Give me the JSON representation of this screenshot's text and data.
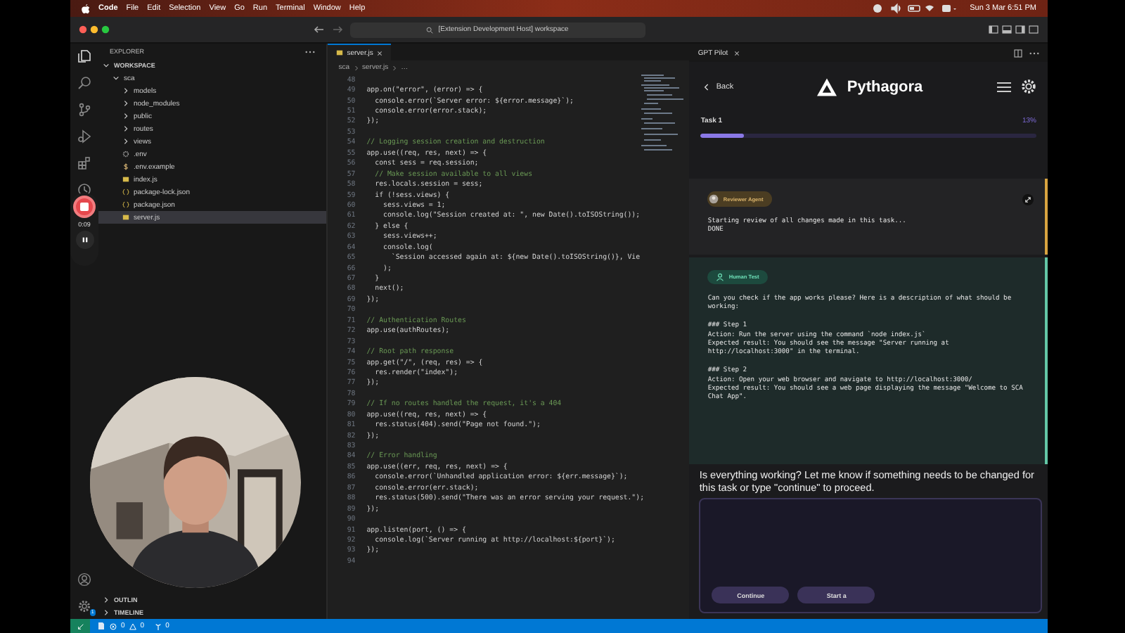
{
  "menu_bar": {
    "app": "Code",
    "items": [
      "File",
      "Edit",
      "Selection",
      "View",
      "Go",
      "Run",
      "Terminal",
      "Window",
      "Help"
    ],
    "clock": "Sun 3 Mar 6:51 PM"
  },
  "title_bar": {
    "command_center": "[Extension Development Host] workspace"
  },
  "activity_bar": {
    "settings_badge": "1"
  },
  "recorder": {
    "time": "0:09"
  },
  "explorer": {
    "title": "EXPLORER",
    "tree": [
      {
        "label": "WORKSPACE",
        "kind": "section",
        "expanded": true,
        "selected": false,
        "children": [
          {
            "label": "sca",
            "kind": "folder",
            "expanded": true,
            "selected": false,
            "children": [
              {
                "label": "models",
                "kind": "folder",
                "expanded": false,
                "selected": false
              },
              {
                "label": "node_modules",
                "kind": "folder",
                "expanded": false,
                "selected": false
              },
              {
                "label": "public",
                "kind": "folder",
                "expanded": false,
                "selected": false
              },
              {
                "label": "routes",
                "kind": "folder",
                "expanded": false,
                "selected": false
              },
              {
                "label": "views",
                "kind": "folder",
                "expanded": false,
                "selected": false
              },
              {
                "label": ".env",
                "kind": "settings",
                "selected": false
              },
              {
                "label": ".env.example",
                "kind": "dollar",
                "selected": false
              },
              {
                "label": "index.js",
                "kind": "js",
                "selected": false
              },
              {
                "label": "package-lock.json",
                "kind": "json",
                "selected": false
              },
              {
                "label": "package.json",
                "kind": "json",
                "selected": false
              },
              {
                "label": "server.js",
                "kind": "js",
                "selected": true
              }
            ]
          }
        ]
      }
    ],
    "bottom_sections": [
      {
        "label": "OUTLIN",
        "expanded": false
      },
      {
        "label": "TIMELINE",
        "expanded": false
      }
    ]
  },
  "editor": {
    "tab": "server.js",
    "breadcrumbs": [
      "sca",
      "server.js",
      "…"
    ],
    "lines": [
      {
        "n": "48"
      },
      {
        "n": "49",
        "text": "app.on(\"error\", (error) => {",
        "kind": "code"
      },
      {
        "n": "50",
        "text": "  console.error(`Server error: ${error.message}`);",
        "kind": "code"
      },
      {
        "n": "51",
        "text": "  console.error(error.stack);",
        "kind": "code"
      },
      {
        "n": "52",
        "text": "});",
        "kind": "code"
      },
      {
        "n": "53"
      },
      {
        "n": "54",
        "text": "// Logging session creation and destruction",
        "kind": "comment"
      },
      {
        "n": "55",
        "text": "app.use((req, res, next) => {",
        "kind": "code"
      },
      {
        "n": "56",
        "text": "  const sess = req.session;",
        "kind": "code"
      },
      {
        "n": "57",
        "text": "  // Make session available to all views",
        "kind": "comment"
      },
      {
        "n": "58",
        "text": "  res.locals.session = sess;",
        "kind": "code"
      },
      {
        "n": "59",
        "text": "  if (!sess.views) {",
        "kind": "code"
      },
      {
        "n": "60",
        "text": "    sess.views = 1;",
        "kind": "code"
      },
      {
        "n": "61",
        "text": "    console.log(\"Session created at: \", new Date().toISOString());",
        "kind": "code"
      },
      {
        "n": "62",
        "text": "  } else {",
        "kind": "code"
      },
      {
        "n": "63",
        "text": "    sess.views++;",
        "kind": "code"
      },
      {
        "n": "64",
        "text": "    console.log(",
        "kind": "code"
      },
      {
        "n": "65",
        "text": "      `Session accessed again at: ${new Date().toISOString()}, Vie",
        "kind": "code"
      },
      {
        "n": "66",
        "text": "    );",
        "kind": "code"
      },
      {
        "n": "67",
        "text": "  }",
        "kind": "code"
      },
      {
        "n": "68",
        "text": "  next();",
        "kind": "code"
      },
      {
        "n": "69",
        "text": "});",
        "kind": "code"
      },
      {
        "n": "70"
      },
      {
        "n": "71",
        "text": "// Authentication Routes",
        "kind": "comment"
      },
      {
        "n": "72",
        "text": "app.use(authRoutes);",
        "kind": "code"
      },
      {
        "n": "73"
      },
      {
        "n": "74",
        "text": "// Root path response",
        "kind": "comment"
      },
      {
        "n": "75",
        "text": "app.get(\"/\", (req, res) => {",
        "kind": "code"
      },
      {
        "n": "76",
        "text": "  res.render(\"index\");",
        "kind": "code"
      },
      {
        "n": "77",
        "text": "});",
        "kind": "code"
      },
      {
        "n": "78"
      },
      {
        "n": "79",
        "text": "// If no routes handled the request, it's a 404",
        "kind": "comment"
      },
      {
        "n": "80",
        "text": "app.use((req, res, next) => {",
        "kind": "code"
      },
      {
        "n": "81",
        "text": "  res.status(404).send(\"Page not found.\");",
        "kind": "code"
      },
      {
        "n": "82",
        "text": "});",
        "kind": "code"
      },
      {
        "n": "83"
      },
      {
        "n": "84",
        "text": "// Error handling",
        "kind": "comment"
      },
      {
        "n": "85",
        "text": "app.use((err, req, res, next) => {",
        "kind": "code"
      },
      {
        "n": "86",
        "text": "  console.error(`Unhandled application error: ${err.message}`);",
        "kind": "code"
      },
      {
        "n": "87",
        "text": "  console.error(err.stack);",
        "kind": "code"
      },
      {
        "n": "88",
        "text": "  res.status(500).send(\"There was an error serving your request.\");",
        "kind": "code"
      },
      {
        "n": "89",
        "text": "});",
        "kind": "code"
      },
      {
        "n": "90"
      },
      {
        "n": "91",
        "text": "app.listen(port, () => {",
        "kind": "code"
      },
      {
        "n": "92",
        "text": "  console.log(`Server running at http://localhost:${port}`);",
        "kind": "code"
      },
      {
        "n": "93",
        "text": "});",
        "kind": "code"
      },
      {
        "n": "94"
      }
    ]
  },
  "pilot": {
    "tab": "GPT Pilot",
    "back": "Back",
    "brand": "Pythagora",
    "task": "Task 1",
    "percent": "13%",
    "level": 0.13,
    "messages": [
      {
        "kind": "reviewer",
        "badge": "Reviewer Agent",
        "text": "Starting review of all changes made in this task...\nDONE"
      },
      {
        "kind": "human_test",
        "badge": "Human Test",
        "text": "Can you check if the app works please? Here is a description of what should be working:\n\n### Step 1\nAction: Run the server using the command `node index.js`\nExpected result: You should see the message \"Server running at http://localhost:3000\" in the terminal.\n\n### Step 2\nAction: Open your web browser and navigate to http://localhost:3000/\nExpected result: You should see a web page displaying the message \"Welcome to SCA Chat App\"."
      }
    ],
    "question": "Is everything working? Let me know if something needs to be changed for this task or type \"continue\" to proceed.",
    "buttons": [
      "Continue",
      "Start a"
    ]
  },
  "status_bar": {
    "errors": "0",
    "warnings": "0",
    "ports": "0"
  }
}
